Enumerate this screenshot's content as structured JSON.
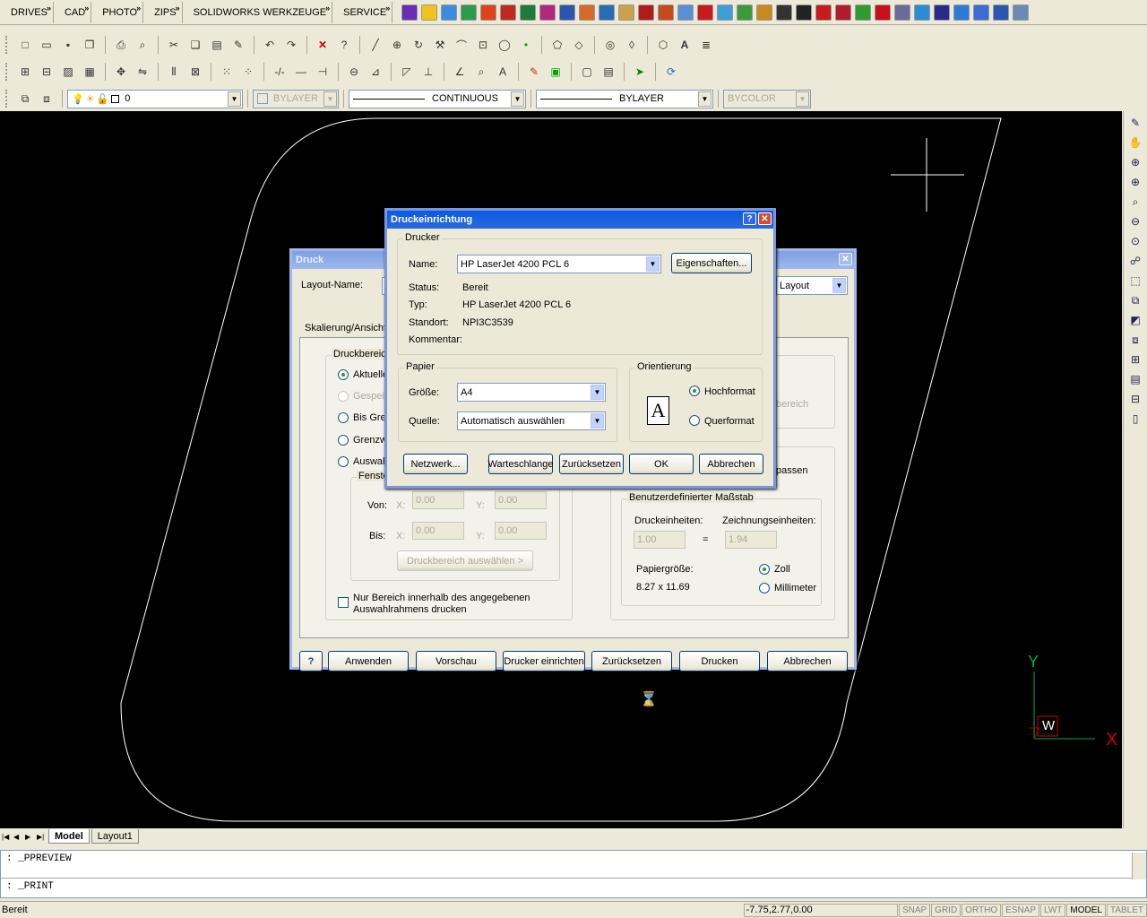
{
  "toolbar_menus": [
    "DRIVES",
    "CAD",
    "PHOTO",
    "ZIPS",
    "SOLIDWORKS WERKZEUGE",
    "SERVICE"
  ],
  "layer_toolbar": {
    "layer": "0",
    "color": "BYLAYER",
    "linetype": "CONTINUOUS",
    "lineweight": "BYLAYER",
    "plotstyle": "BYCOLOR"
  },
  "layout_tabs": [
    "Model",
    "Layout1"
  ],
  "command_lines": [
    ": _PPREVIEW",
    ": _PRINT"
  ],
  "status": {
    "text": "Bereit",
    "coords": "-7.75,2.77,0.00",
    "toggles": [
      "SNAP",
      "GRID",
      "ORTHO",
      "ESNAP",
      "LWT",
      "MODEL",
      "TABLET"
    ],
    "active_toggle": "MODEL"
  },
  "ucs": {
    "y": "Y",
    "x": "X",
    "w": "W"
  },
  "druck": {
    "title": "Druck",
    "layout_name_label": "Layout-Name:",
    "layout_combo": "Layout",
    "tab_label": "Skalierung/Ansicht",
    "area_group": "Druckbereich",
    "area_options": [
      "Aktuelle",
      "Gespeic",
      "Bis Gren",
      "Grenzw",
      "Auswahl"
    ],
    "window_group": "Fenster",
    "from_label": "Von:",
    "to_label": "Bis:",
    "x_label": "X:",
    "y_label": "Y:",
    "from_x": "0.00",
    "from_y": "0.00",
    "to_x": "0.00",
    "to_y": "0.00",
    "select_area_btn": "Druckbereich auswählen >",
    "only_area_check": "Nur Bereich innerhalb des angegebenen Auswahlrahmens drucken",
    "area_right_label": "bereich",
    "fit_label": "passen",
    "scale_group": "Benutzerdefinierter Maßstab",
    "print_units_label": "Druckeinheiten:",
    "drawing_units_label": "Zeichnungseinheiten:",
    "print_units": "1.00",
    "equals": "=",
    "drawing_units": "1.94",
    "paper_size_label": "Papiergröße:",
    "paper_size": "8.27 x 11.69",
    "unit_inch": "Zoll",
    "unit_mm": "Millimeter",
    "buttons": {
      "help": "?",
      "apply": "Anwenden",
      "preview": "Vorschau",
      "setup": "Drucker einrichten",
      "reset": "Zurücksetzen",
      "print": "Drucken",
      "cancel": "Abbrechen"
    }
  },
  "setup": {
    "title": "Druckeinrichtung",
    "printer_group": "Drucker",
    "name_label": "Name:",
    "name_value": "HP LaserJet 4200 PCL 6",
    "properties_btn": "Eigenschaften...",
    "status_label": "Status:",
    "status_value": "Bereit",
    "type_label": "Typ:",
    "type_value": "HP LaserJet 4200 PCL 6",
    "location_label": "Standort:",
    "location_value": "NPI3C3539",
    "comment_label": "Kommentar:",
    "paper_group": "Papier",
    "size_label": "Größe:",
    "size_value": "A4",
    "source_label": "Quelle:",
    "source_value": "Automatisch auswählen",
    "orientation_group": "Orientierung",
    "portrait": "Hochformat",
    "landscape": "Querformat",
    "orientation_glyph": "A",
    "buttons": {
      "network": "Netzwerk...",
      "queue": "Warteschlange",
      "reset": "Zurücksetzen",
      "ok": "OK",
      "cancel": "Abbrechen"
    }
  }
}
